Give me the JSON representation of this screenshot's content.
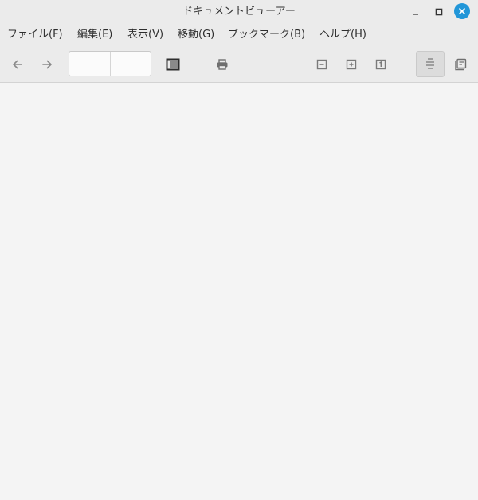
{
  "window": {
    "title": "ドキュメントビューアー"
  },
  "menubar": {
    "items": [
      {
        "label": "ファイル(F)"
      },
      {
        "label": "編集(E)"
      },
      {
        "label": "表示(V)"
      },
      {
        "label": "移動(G)"
      },
      {
        "label": "ブックマーク(B)"
      },
      {
        "label": "ヘルプ(H)"
      }
    ]
  },
  "toolbar": {
    "page_entry": {
      "value": "",
      "placeholder": ""
    },
    "page_count": {
      "value": ""
    }
  },
  "colors": {
    "accent": "#2196d8",
    "chrome": "#ebebeb",
    "content_bg": "#f4f4f4"
  },
  "icons": {
    "back": "arrow-left-icon",
    "forward": "arrow-right-icon",
    "sidebar": "sidebar-toggle-icon",
    "print": "printer-icon",
    "zoom_out": "zoom-out-icon",
    "zoom_in": "zoom-in-icon",
    "zoom_original": "zoom-original-icon",
    "continuous": "continuous-scroll-icon",
    "dual_page": "dual-page-icon"
  }
}
